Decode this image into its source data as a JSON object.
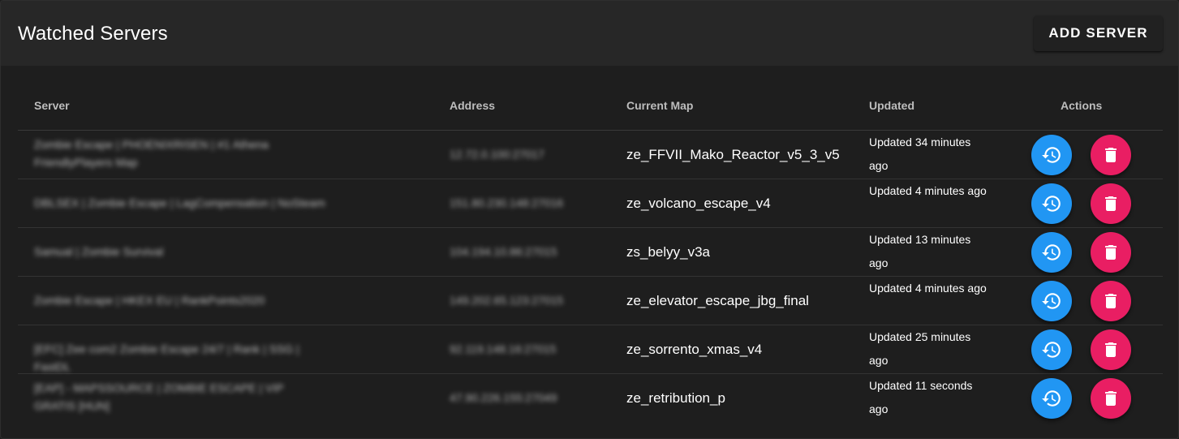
{
  "header": {
    "title": "Watched Servers",
    "add_button": "ADD SERVER"
  },
  "table": {
    "columns": {
      "server": "Server",
      "address": "Address",
      "map": "Current Map",
      "updated": "Updated",
      "actions": "Actions"
    },
    "rows": [
      {
        "server": "Zombie Escape | PHOENIXRISEN | #1 Athena FriendlyPlayers Map",
        "address": "12.72.0.100:27017",
        "map": "ze_FFVII_Mako_Reactor_v5_3_v5",
        "updated": "Updated 34 minutes ago"
      },
      {
        "server": "DBLSEX | Zombie Escape | LagCompensation | NoSteam",
        "address": "151.80.230.148:27016",
        "map": "ze_volcano_escape_v4",
        "updated": "Updated 4 minutes ago"
      },
      {
        "server": "Samual | Zombie Survival",
        "address": "104.194.10.86:27015",
        "map": "zs_belyy_v3a",
        "updated": "Updated 13 minutes ago"
      },
      {
        "server": "Zombie Escape | HKEX EU | RankPoints2020",
        "address": "149.202.65.123:27015",
        "map": "ze_elevator_escape_jbg_final",
        "updated": "Updated 4 minutes ago"
      },
      {
        "server": "[EFC] Zee com2 Zombie Escape 24/7 | Rank | SSG | FastDL",
        "address": "92.119.148.16:27015",
        "map": "ze_sorrento_xmas_v4",
        "updated": "Updated 25 minutes ago"
      },
      {
        "server": "[EAP] - MAPSSOURCE | ZOMBIE ESCAPE | VIP GRATIS [HUN]",
        "address": "47.90.226.155:27049",
        "map": "ze_retribution_p",
        "updated": "Updated 11 seconds ago"
      }
    ]
  },
  "colors": {
    "history_button": "#2196f3",
    "delete_button": "#e91e63",
    "background": "#1e1e1e",
    "header_background": "#272727"
  },
  "icons": {
    "history": "history-icon",
    "delete": "trash-icon"
  }
}
